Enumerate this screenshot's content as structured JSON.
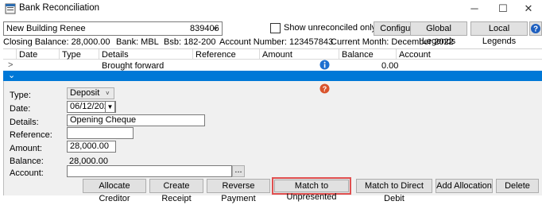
{
  "window": {
    "title": "Bank Reconciliation",
    "controls": {
      "minimize": "─",
      "maximize": "☐",
      "close": "✕"
    }
  },
  "toolbar": {
    "account_name": "New Building Renee",
    "account_code": "839406",
    "show_unreconciled_label": "Show unreconciled only",
    "show_unreconciled_checked": false,
    "configuration_label": "Configuration",
    "global_legends_label": "Global Legends",
    "local_legends_label": "Local Legends",
    "help_glyph": "?"
  },
  "info": {
    "closing_balance": "Closing Balance: 28,000.00",
    "bank": "Bank: MBL",
    "bsb": "Bsb: 182-200",
    "account_number": "Account Number: 123457843",
    "current_month": "Current Month: December 2022"
  },
  "grid": {
    "columns": [
      "Date",
      "Type",
      "Details",
      "Reference",
      "Amount",
      "Balance",
      "Account"
    ],
    "rows": [
      {
        "expander": ">",
        "details": "Brought forward",
        "balance": "0.00",
        "has_info_icon": true
      }
    ],
    "selected_expander": "⌄"
  },
  "detail_form": {
    "type_label": "Type:",
    "type_value": "Deposit",
    "date_label": "Date:",
    "date_value": "06/12/2022",
    "details_label": "Details:",
    "details_value": "Opening Cheque",
    "reference_label": "Reference:",
    "reference_value": "",
    "amount_label": "Amount:",
    "amount_value": "28,000.00",
    "balance_label": "Balance:",
    "balance_value": "28,000.00",
    "account_label": "Account:",
    "account_value": "",
    "browse_label": "..."
  },
  "actions": {
    "allocate_creditor": "Allocate Creditor",
    "create_receipt": "Create Receipt",
    "reverse_payment": "Reverse Payment",
    "match_to_unpresented": "Match to Unpresented",
    "match_to_direct_debit": "Match to Direct Debit",
    "add_allocation": "Add Allocation",
    "delete": "Delete"
  },
  "colors": {
    "selection": "#0078d7",
    "info_icon": "#1e6fd0",
    "question_icon": "#d9532c",
    "highlight_border": "#e05050"
  }
}
